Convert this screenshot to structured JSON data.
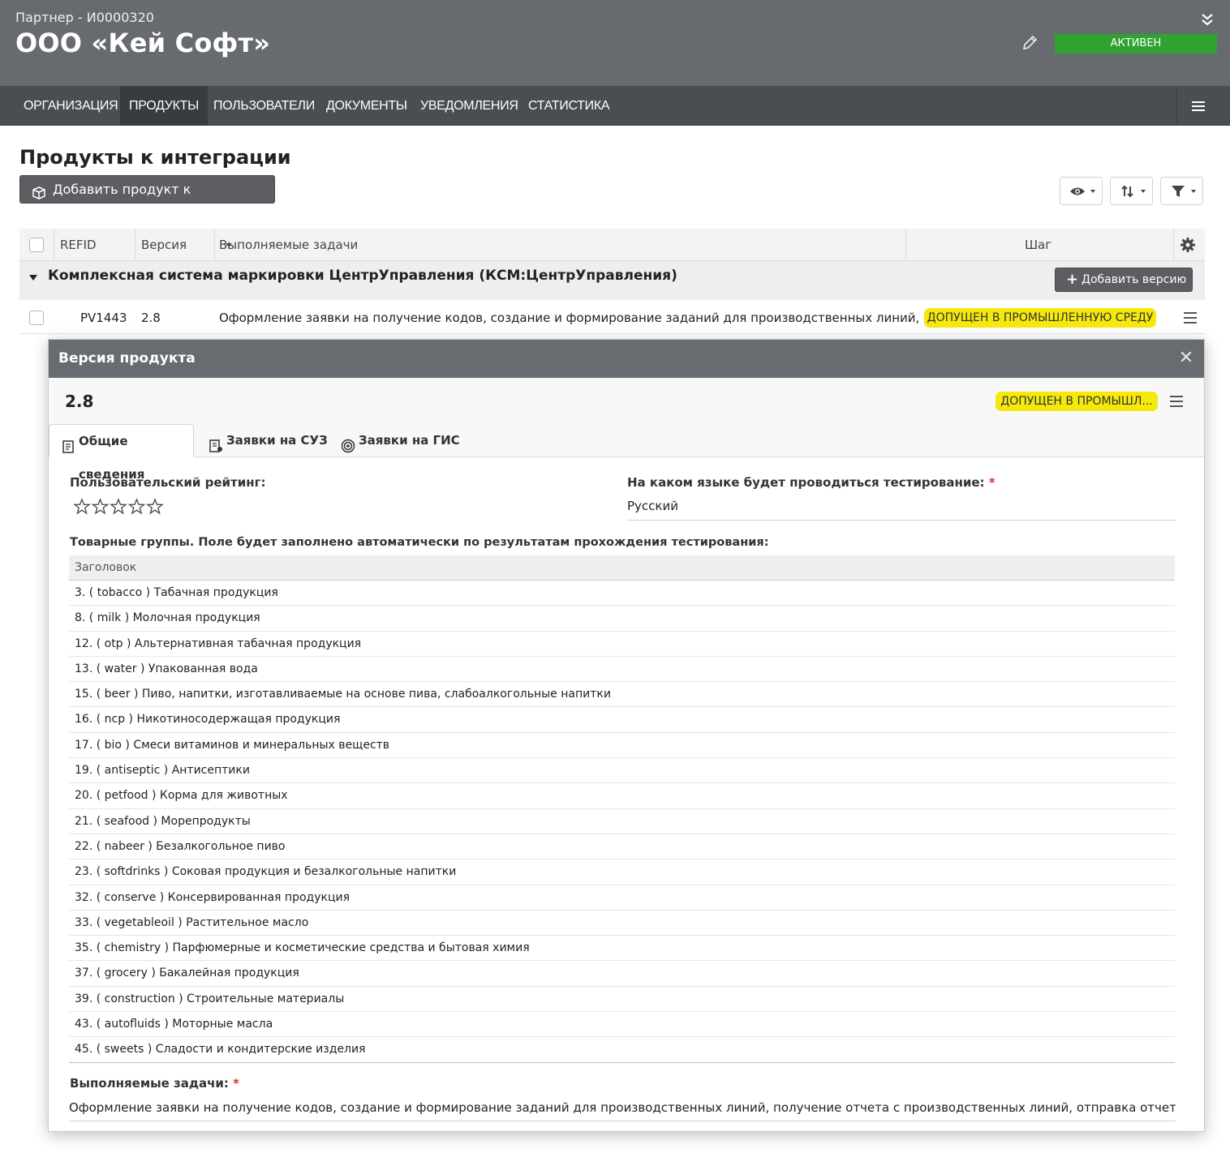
{
  "header": {
    "partner_label": "Партнер - И0000320",
    "org_title": "ООО «Кей Софт»",
    "status": "АКТИВЕН",
    "status_color": "#2fa22f"
  },
  "nav": {
    "items": [
      "ОРГАНИЗАЦИЯ",
      "ПРОДУКТЫ",
      "ПОЛЬЗОВАТЕЛИ",
      "ДОКУМЕНТЫ",
      "УВЕДОМЛЕНИЯ",
      "СТАТИСТИКА"
    ],
    "active": "ПРОДУКТЫ"
  },
  "page": {
    "title": "Продукты к интеграции",
    "add_button": "Добавить продукт к интеграции"
  },
  "table": {
    "columns": [
      "REFID",
      "Версия",
      "Выполняемые задачи",
      "Шаг"
    ],
    "group": {
      "title": "Комплексная система маркировки ЦентрУправления (КСМ:ЦентрУправления)",
      "add_version": "Добавить версию"
    },
    "rows": [
      {
        "refid": "PV1443",
        "version": "2.8",
        "tasks": "Оформление заявки на получение кодов, создание и формирование заданий для производственных линий, по...",
        "step": "ДОПУЩЕН В ПРОМЫШЛЕННУЮ СРЕДУ"
      }
    ]
  },
  "modal": {
    "title": "Версия продукта",
    "version": "2.8",
    "status": "ДОПУЩЕН В ПРОМЫШЛ...",
    "status_color": "#f4e80c",
    "tabs": [
      "Общие сведения",
      "Заявки на СУЗ",
      "Заявки на ГИС"
    ],
    "active_tab": "Общие сведения",
    "rating_label": "Пользовательский рейтинг:",
    "rating_value": 0,
    "rating_max": 5,
    "language_label": "На каком языке будет проводиться тестирование:",
    "required_mark": "*",
    "language_value": "Русский",
    "groups_label": "Товарные группы. Поле будет заполнено автоматически по результатам прохождения тестирования:",
    "groups_header": "Заголовок",
    "groups": [
      "3. ( tobacco ) Табачная продукция",
      "8. ( milk ) Молочная продукция",
      "12. ( otp ) Альтернативная табачная продукция",
      "13. ( water ) Упакованная вода",
      "15. ( beer ) Пиво, напитки, изготавливаемые на основе пива, слабоалкогольные напитки",
      "16. ( ncp ) Никотиносодержащая продукция",
      "17. ( bio ) Смеси витаминов и минеральных веществ",
      "19. ( antiseptic ) Антисептики",
      "20. ( petfood ) Корма для животных",
      "21. ( seafood ) Морепродукты",
      "22. ( nabeer ) Безалкогольное пиво",
      "23. ( softdrinks ) Соковая продукция и безалкогольные напитки",
      "32. ( conserve ) Консервированная продукция",
      "33. ( vegetableoil ) Растительное масло",
      "35. ( chemistry ) Парфюмерные и косметические средства и бытовая химия",
      "37. ( grocery ) Бакалейная продукция",
      "39. ( construction ) Строительные материалы",
      "43. ( autofluids ) Моторные масла",
      "45. ( sweets ) Сладости и кондитерские изделия"
    ],
    "tasks_label": "Выполняемые задачи:",
    "tasks_value": "Оформление заявки на получение кодов, создание и формирование заданий для производственных линий, получение отчета с производственных линий, отправка отчета о нанесении"
  }
}
